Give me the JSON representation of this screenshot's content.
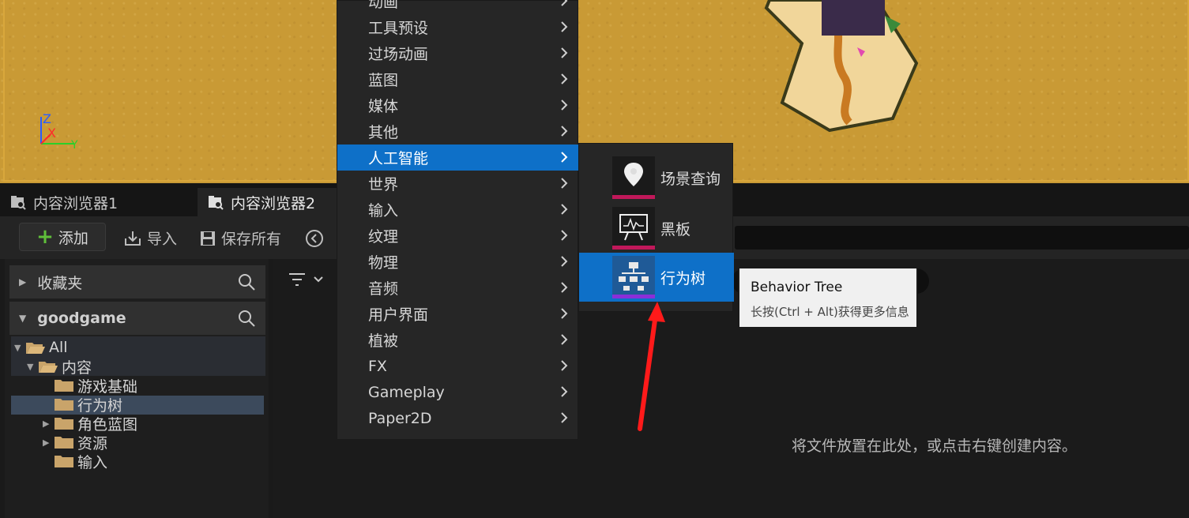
{
  "tabs": [
    {
      "label": "内容浏览器1",
      "active": false
    },
    {
      "label": "内容浏览器2",
      "active": true
    }
  ],
  "toolbar": {
    "add_label": "添加",
    "import_label": "导入",
    "save_all_label": "保存所有"
  },
  "left": {
    "favorites_label": "收藏夹",
    "project_label": "goodgame",
    "tree": {
      "all": "All",
      "content": "内容",
      "game_base": "游戏基础",
      "behavior_tree": "行为树",
      "character_bp": "角色蓝图",
      "resources": "资源",
      "input": "输入"
    }
  },
  "right": {
    "empty_message": "将文件放置在此处，或点击右键创建内容。"
  },
  "menu": {
    "items": [
      "动画",
      "工具预设",
      "过场动画",
      "蓝图",
      "媒体",
      "其他",
      "人工智能",
      "世界",
      "输入",
      "纹理",
      "物理",
      "音频",
      "用户界面",
      "植被",
      "FX",
      "Gameplay",
      "Paper2D"
    ],
    "highlighted": "人工智能"
  },
  "submenu": {
    "items": [
      {
        "label": "场景查询",
        "icon": "env-query-icon",
        "bar_color": "#c0185a"
      },
      {
        "label": "黑板",
        "icon": "blackboard-icon",
        "bar_color": "#c0185a"
      },
      {
        "label": "行为树",
        "icon": "behavior-tree-icon",
        "bar_color": "#8a2fd8"
      }
    ],
    "highlighted": "行为树"
  },
  "tooltip": {
    "title": "Behavior Tree",
    "hint": "长按(Ctrl + Alt)获得更多信息"
  },
  "colors": {
    "accent": "#0e70c8",
    "viewport_sand": "#c99a35",
    "annotation_arrow": "#ff1a1a"
  }
}
